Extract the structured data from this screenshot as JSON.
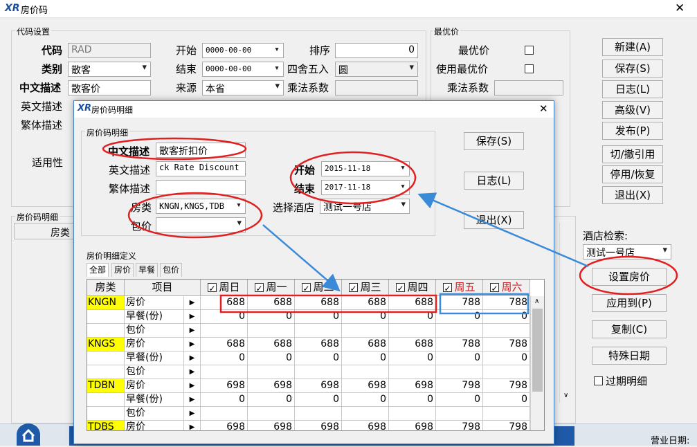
{
  "main": {
    "title": "房价码",
    "group_code": "代码设置",
    "group_best": "最优价",
    "code_label": "代码",
    "code_value": "RAD",
    "type_label": "类别",
    "type_value": "散客",
    "cn_desc_label": "中文描述",
    "cn_desc_value": "散客价",
    "en_desc_label": "英文描述",
    "tw_desc_label": "繁体描述",
    "applic_label": "适用性",
    "start_label": "开始",
    "start_value": "0000-00-00",
    "end_label": "结束",
    "end_value": "0000-00-00",
    "source_label": "来源",
    "source_value": "本省",
    "sort_label": "排序",
    "sort_value": "0",
    "rounding_label": "四舍五入",
    "rounding_value": "圆",
    "multiplier_label": "乘法系数",
    "best_price_label": "最优价",
    "use_best_price_label": "使用最优价",
    "best_multiplier_label": "乘法系数",
    "detail_group": "房价码明细",
    "detail_col_roomtype": "房类",
    "hotel_search_label": "酒店检索:",
    "hotel_search_value": "测试一号店",
    "expired_label": "过期明细",
    "status_text": "营业日期:",
    "buttons": {
      "new": "新建(A)",
      "save": "保存(S)",
      "log": "日志(L)",
      "advanced": "高级(V)",
      "publish": "发布(P)",
      "toggle_ref": "切/撤引用",
      "disable": "停用/恢复",
      "exit": "退出(X)",
      "set_price": "设置房价",
      "apply_to": "应用到(P)",
      "copy": "复制(C)",
      "special_date": "特殊日期"
    }
  },
  "dialog": {
    "title": "房价码明细",
    "group": "房价码明细",
    "cn_desc_label": "中文描述",
    "cn_desc_value": "散客折扣价",
    "en_desc_label": "英文描述",
    "en_desc_value": "ck Rate Discount",
    "tw_desc_label": "繁体描述",
    "roomtype_label": "房类",
    "roomtype_value": "KNGN,KNGS,TDB",
    "package_label": "包价",
    "start_label": "开始",
    "start_value": "2015-11-18",
    "end_label": "结束",
    "end_value": "2017-11-18",
    "hotel_label": "选择酒店",
    "hotel_value": "测试一号店",
    "save": "保存(S)",
    "log": "日志(L)",
    "exit": "退出(X)",
    "define_group": "房价明细定义",
    "tabs": [
      "全部",
      "房价",
      "早餐",
      "包价"
    ],
    "grid": {
      "col_roomtype": "房类",
      "col_item": "项目",
      "days": [
        "周日",
        "周一",
        "周二",
        "周三",
        "周四",
        "周五",
        "周六"
      ],
      "rows": [
        {
          "rt": "KNGN",
          "item": "房价",
          "vals": [
            "688",
            "688",
            "688",
            "688",
            "688",
            "788",
            "788"
          ]
        },
        {
          "rt": "",
          "item": "早餐(份)",
          "vals": [
            "0",
            "0",
            "0",
            "0",
            "0",
            "0",
            "0"
          ]
        },
        {
          "rt": "",
          "item": "包价",
          "vals": [
            "",
            "",
            "",
            "",
            "",
            "",
            ""
          ]
        },
        {
          "rt": "KNGS",
          "item": "房价",
          "vals": [
            "688",
            "688",
            "688",
            "688",
            "688",
            "788",
            "788"
          ]
        },
        {
          "rt": "",
          "item": "早餐(份)",
          "vals": [
            "0",
            "0",
            "0",
            "0",
            "0",
            "0",
            "0"
          ]
        },
        {
          "rt": "",
          "item": "包价",
          "vals": [
            "",
            "",
            "",
            "",
            "",
            "",
            ""
          ]
        },
        {
          "rt": "TDBN",
          "item": "房价",
          "vals": [
            "698",
            "698",
            "698",
            "698",
            "698",
            "798",
            "798"
          ]
        },
        {
          "rt": "",
          "item": "早餐(份)",
          "vals": [
            "0",
            "0",
            "0",
            "0",
            "0",
            "0",
            "0"
          ]
        },
        {
          "rt": "",
          "item": "包价",
          "vals": [
            "",
            "",
            "",
            "",
            "",
            "",
            ""
          ]
        },
        {
          "rt": "TDBS",
          "item": "房价",
          "vals": [
            "698",
            "698",
            "698",
            "698",
            "698",
            "798",
            "798"
          ]
        }
      ]
    }
  },
  "colors": {
    "highlight_red": "#e02020",
    "highlight_blue": "#3a8ad8",
    "roomtype_bg": "#ffff00",
    "weekend": "#d81818"
  }
}
